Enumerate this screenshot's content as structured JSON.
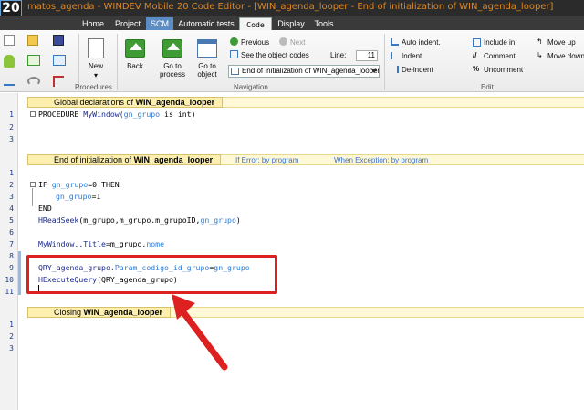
{
  "window": {
    "logo": "20",
    "title": "matos_agenda - WINDEV Mobile 20  Code Editor - [WIN_agenda_looper - End of initialization of WIN_agenda_looper]"
  },
  "tabs": [
    "Home",
    "Project",
    "SCM",
    "Automatic tests",
    "Code",
    "Display",
    "Tools"
  ],
  "ribbon": {
    "procedures_group": "Procedures",
    "new_label": "New",
    "back_label": "Back",
    "go_to_process_label": "Go to\nprocess",
    "go_to_object_label": "Go to\nobject",
    "previous_label": "Previous",
    "next_label": "Next",
    "see_codes_label": "See the object codes",
    "line_label": "Line:",
    "line_value": "11",
    "combo_value": "End of initialization of WIN_agenda_looper",
    "navigation_group": "Navigation",
    "auto_indent_label": "Auto indent.",
    "indent_label": "Indent",
    "deindent_label": "De-indent",
    "include_in_label": "Include in",
    "comment_label": "Comment",
    "uncomment_label": "Uncomment",
    "move_up_label": "Move up",
    "move_down_label": "Move down",
    "edit_group": "Edit"
  },
  "sections": {
    "global": {
      "prefix": "Global declarations of ",
      "name": "WIN_agenda_looper"
    },
    "end_init": {
      "prefix": "End of initialization of ",
      "name": "WIN_agenda_looper",
      "if_error": "If Error: by program",
      "when_exception": "When Exception: by program"
    },
    "closing": {
      "prefix": "Closing ",
      "name": "WIN_agenda_looper"
    }
  },
  "code_global": {
    "line1_kw": "PROCEDURE ",
    "line1_name": "MyWindow(",
    "line1_var": "gn_grupo",
    "line1_rest": " is int)"
  },
  "code_end_init": {
    "l2_kw": "IF ",
    "l2_var": "gn_grupo",
    "l2_rest": "=0 THEN",
    "l3_var": "gn_grupo",
    "l3_rest": "=1",
    "l4": "END",
    "l5_fn": "HReadSeek",
    "l5_args": "(m_grupo,m_grupo.m_grupoID,",
    "l5_var": "gn_grupo",
    "l5_end": ")",
    "l7_obj": "MyWindow..Title",
    "l7_rest": "=m_grupo.",
    "l7_prop": "nome",
    "l9_obj": "QRY_agenda_grupo.",
    "l9_prop": "Param_codigo_id_grupo",
    "l9_eq": "=",
    "l9_var": "gn_grupo",
    "l10_fn": "HExecuteQuery",
    "l10_args": "(QRY_agenda_grupo)"
  },
  "line_numbers": {
    "global": [
      "1",
      "2",
      "3"
    ],
    "end_init": [
      "1",
      "2",
      "3",
      "4",
      "5",
      "6",
      "7",
      "8",
      "9",
      "10",
      "11"
    ],
    "closing": [
      "1",
      "2",
      "3"
    ]
  },
  "colors": {
    "title_text": "#e0871f",
    "annotation_red": "#dd2020",
    "section_bg": "#fff8d6"
  }
}
